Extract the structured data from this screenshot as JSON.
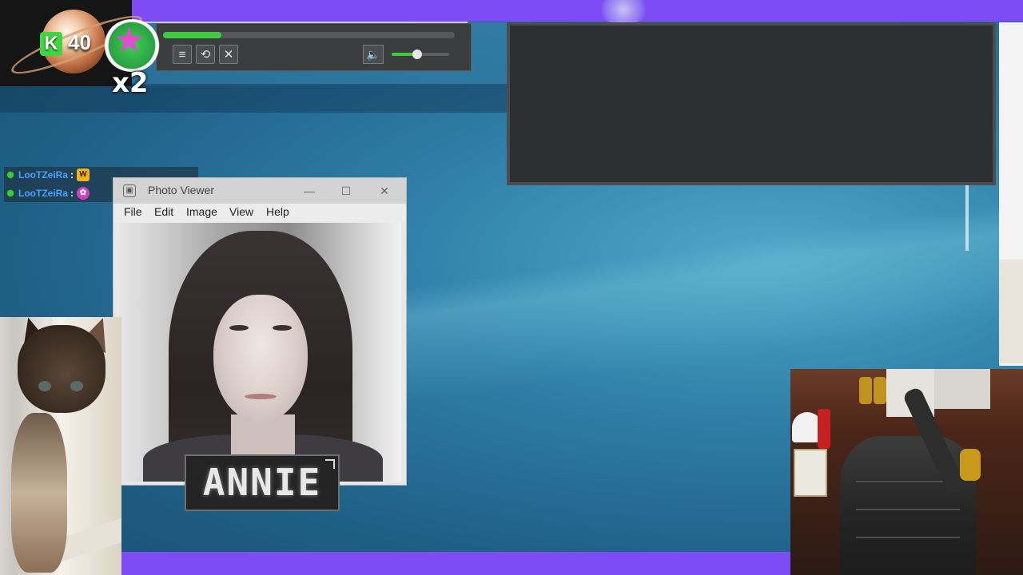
{
  "overlay": {
    "points_icon": "K",
    "points_value": "40",
    "multiplier": "x2",
    "gem_icon": "star-gem-icon"
  },
  "media_player": {
    "progress_fraction": 0.2,
    "volume_fraction": 0.45,
    "buttons": [
      {
        "name": "playlist-button",
        "icon": "≡"
      },
      {
        "name": "repeat-button",
        "icon": "⟲"
      },
      {
        "name": "close-player-button",
        "icon": "✕"
      }
    ],
    "volume_icon": "🔈"
  },
  "chat": {
    "messages": [
      {
        "user": "LooTZeiRa",
        "emote": "W"
      },
      {
        "user": "LooTZeiRa",
        "emote": "✿"
      }
    ]
  },
  "photo_viewer": {
    "title": "Photo Viewer",
    "controls": {
      "minimize": "—",
      "maximize": "☐",
      "close": "✕"
    },
    "menu": [
      "File",
      "Edit",
      "Image",
      "View",
      "Help"
    ]
  },
  "name_tag": {
    "text": "ANNIE"
  },
  "colors": {
    "accent_purple": "#7d4cf4",
    "progress_green": "#3fcb3f",
    "chat_username": "#4aa0ff"
  }
}
